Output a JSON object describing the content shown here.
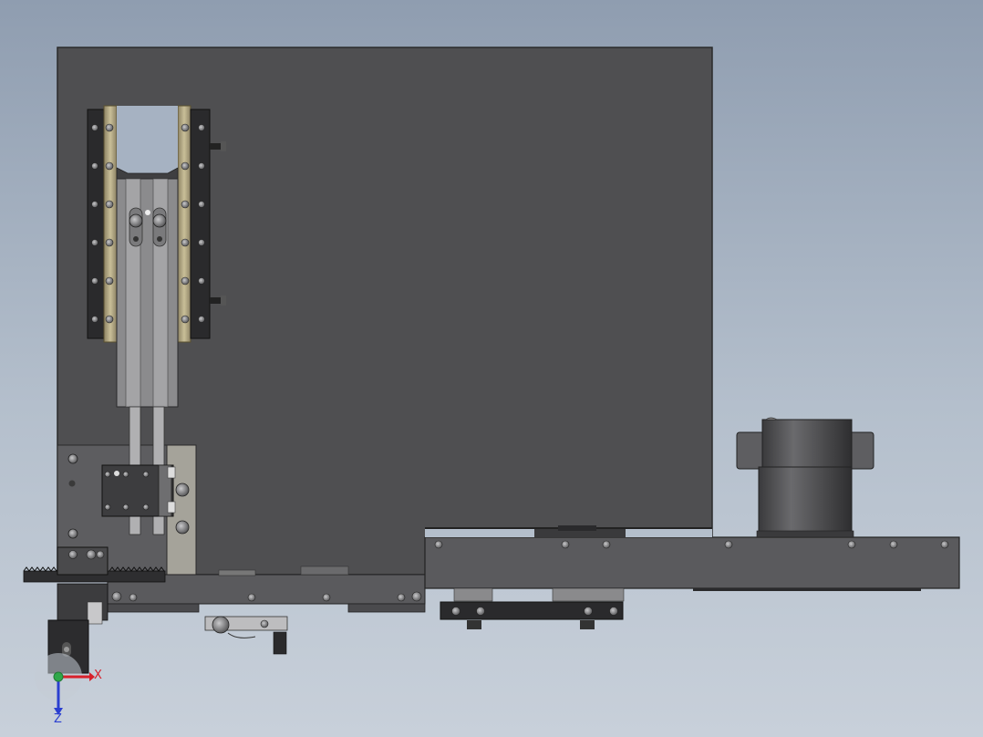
{
  "scene": {
    "background_top": "#8f9db0",
    "background_bottom": "#c8d0da",
    "part_dark": "#4f4f51",
    "part_mid": "#6b6b6e",
    "part_light": "#8a8a8c",
    "rail_gold": "#b8ad86",
    "block_black": "#2a2a2c"
  },
  "triad": {
    "x_label": "X",
    "z_label": "Z",
    "x_color": "#d8202a",
    "z_color": "#2b3fd0",
    "origin_color": "#2fa84a"
  }
}
